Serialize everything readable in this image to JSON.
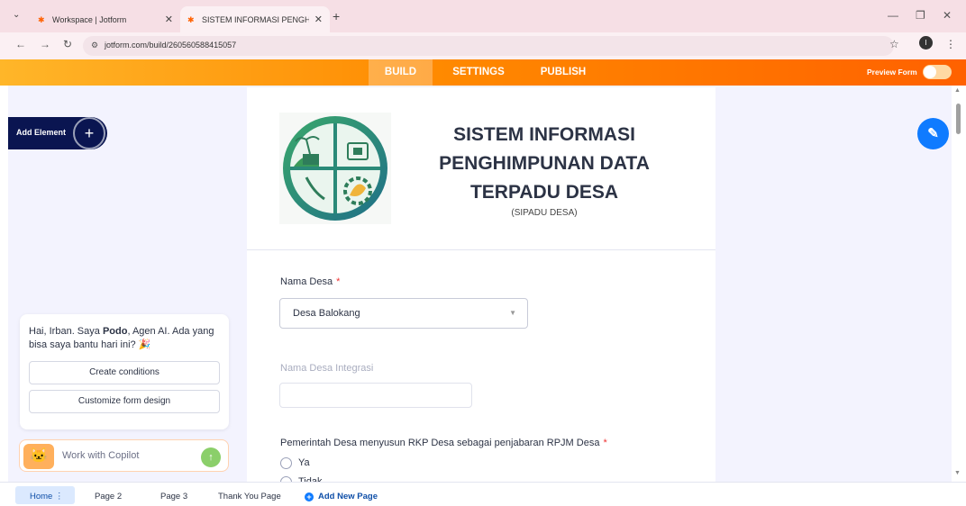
{
  "browser": {
    "tabs": [
      {
        "title": "Workspace | Jotform",
        "active": false
      },
      {
        "title": "SISTEM INFORMASI PENGHIMI",
        "active": true
      }
    ],
    "url": "jotform.com/build/260560588415057",
    "avatar_letter": "I"
  },
  "appbar": {
    "menu": [
      "BUILD",
      "SETTINGS",
      "PUBLISH"
    ],
    "active": "BUILD",
    "preview_label": "Preview Form",
    "colors": {
      "start": "#ffb629",
      "end": "#ff6100"
    }
  },
  "left_panel": {
    "add_element_label": "Add Element"
  },
  "form": {
    "header": {
      "title_lines": [
        "SISTEM INFORMASI",
        "PENGHIMPUNAN DATA",
        "TERPADU DESA"
      ],
      "subtitle": "(SIPADU DESA)"
    },
    "fields": {
      "nama_desa": {
        "label": "Nama Desa",
        "required_mark": "*",
        "value": "Desa Balokang"
      },
      "nama_desa_integrasi": {
        "label": "Nama Desa Integrasi",
        "value": ""
      },
      "rkp_question": {
        "label": "Pemerintah Desa menyusun RKP Desa sebagai penjabaran RPJM Desa",
        "required_mark": "*",
        "options": [
          "Ya",
          "Tidak"
        ]
      }
    }
  },
  "assistant": {
    "message_prefix": "Hai, Irban. Saya ",
    "name": "Podo",
    "message_suffix": ", Agen AI. Ada yang bisa saya bantu hari ini? 🎉",
    "buttons": [
      "Create conditions",
      "Customize form design"
    ],
    "copilot_label": "Work with Copilot"
  },
  "pages": {
    "items": [
      "Home",
      "Page 2",
      "Page 3",
      "Thank You Page"
    ],
    "add_label": "Add New Page"
  }
}
